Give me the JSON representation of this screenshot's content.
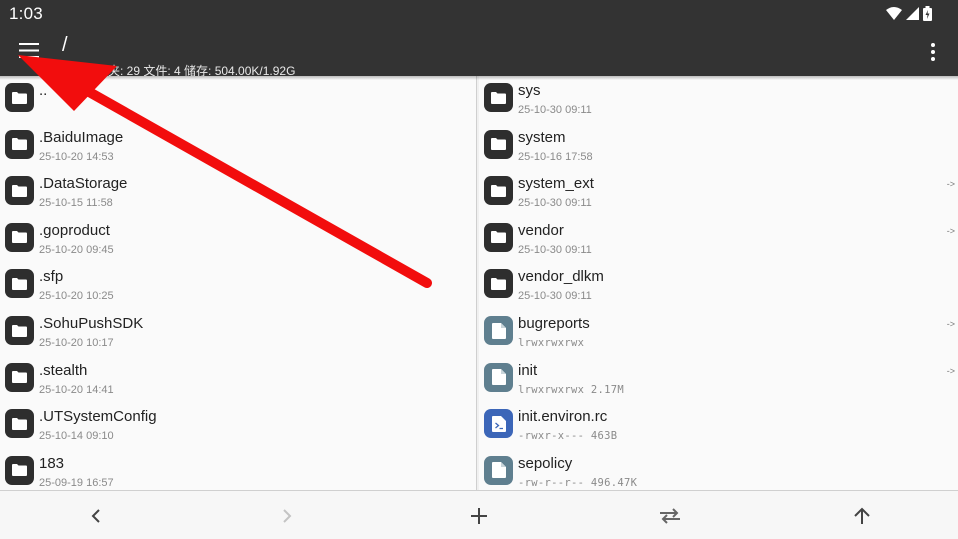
{
  "status_bar": {
    "time": "1:03",
    "icons": [
      "wifi-icon",
      "signal-icon",
      "battery-icon"
    ]
  },
  "app_bar": {
    "path": "/",
    "summary": "文件夹: 29  文件: 4  储存: 504.00K/1.92G",
    "menu_icon": "hamburger-menu-icon",
    "overflow_icon": "more-vert-icon"
  },
  "left_pane": {
    "items": [
      {
        "name": "..",
        "meta": "",
        "type": "folder"
      },
      {
        "name": ".BaiduImage",
        "meta": "25-10-20 14:53",
        "type": "folder"
      },
      {
        "name": ".DataStorage",
        "meta": "25-10-15 11:58",
        "type": "folder"
      },
      {
        "name": ".goproduct",
        "meta": "25-10-20 09:45",
        "type": "folder"
      },
      {
        "name": ".sfp",
        "meta": "25-10-20 10:25",
        "type": "folder"
      },
      {
        "name": ".SohuPushSDK",
        "meta": "25-10-20 10:17",
        "type": "folder"
      },
      {
        "name": ".stealth",
        "meta": "25-10-20 14:41",
        "type": "folder"
      },
      {
        "name": ".UTSystemConfig",
        "meta": "25-10-14 09:10",
        "type": "folder"
      },
      {
        "name": "183",
        "meta": "25-09-19 16:57",
        "type": "folder"
      }
    ]
  },
  "right_pane": {
    "items": [
      {
        "name": "sys",
        "meta": "25-10-30 09:11",
        "type": "folder",
        "link": ""
      },
      {
        "name": "system",
        "meta": "25-10-16 17:58",
        "type": "folder",
        "link": ""
      },
      {
        "name": "system_ext",
        "meta": "25-10-30 09:11",
        "type": "folder",
        "link": "->"
      },
      {
        "name": "vendor",
        "meta": "25-10-30 09:11",
        "type": "folder",
        "link": "->"
      },
      {
        "name": "vendor_dlkm",
        "meta": "25-10-30 09:11",
        "type": "folder",
        "link": ""
      },
      {
        "name": "bugreports",
        "meta": "lrwxrwxrwx",
        "type": "file",
        "link": "->"
      },
      {
        "name": "init",
        "meta": "lrwxrwxrwx  2.17M",
        "type": "file",
        "link": "->"
      },
      {
        "name": "init.environ.rc",
        "meta": "-rwxr-x---  463B",
        "type": "script",
        "link": ""
      },
      {
        "name": "sepolicy",
        "meta": "-rw-r--r--  496.47K",
        "type": "file",
        "link": ""
      }
    ]
  },
  "bottom_bar": {
    "buttons": [
      "back-icon",
      "forward-icon",
      "add-icon",
      "swap-icon",
      "up-icon"
    ]
  },
  "colors": {
    "bar": "#333333",
    "annotation_arrow": "#f20d0d",
    "script_icon": "#3c66b8",
    "file_icon": "#5f7f8f"
  }
}
